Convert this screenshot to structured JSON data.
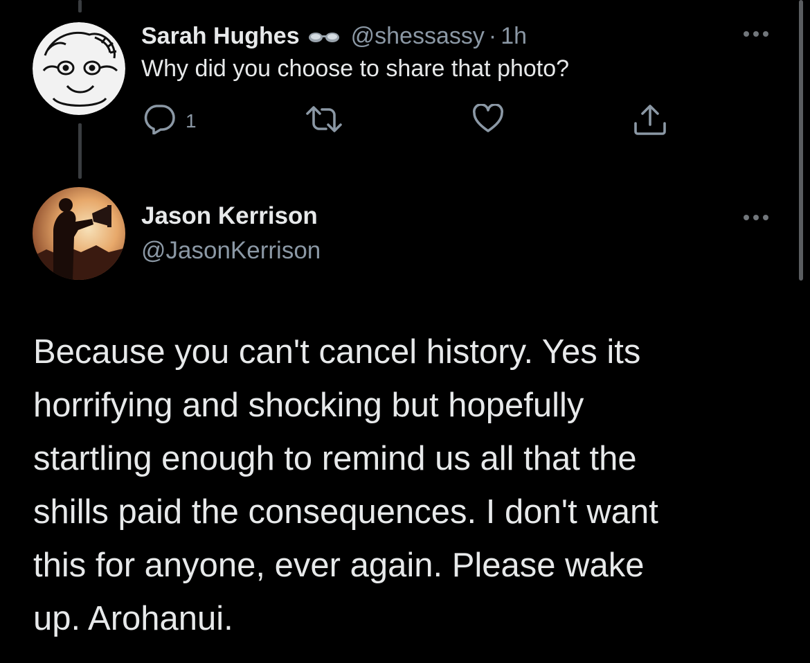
{
  "parent_tweet": {
    "display_name": "Sarah Hughes",
    "badge_icon": "glasses-icon",
    "handle": "@shessassy",
    "separator": "·",
    "time": "1h",
    "text": "Why did you choose to share that photo?",
    "reply_count": "1",
    "actions": [
      "reply-icon",
      "retweet-icon",
      "like-icon",
      "share-icon"
    ]
  },
  "main_tweet": {
    "display_name": "Jason Kerrison",
    "handle": "@JasonKerrison",
    "text_lines": [
      "Because you can't cancel history. Yes its",
      "horrifying and shocking but hopefully",
      "startling enough to remind us all that the",
      "shills paid the consequences. I don't want",
      "this for anyone, ever again. Please wake",
      "up. Arohanui."
    ]
  },
  "colors": {
    "background": "#000000",
    "primary_text": "#e7e9ea",
    "secondary_text": "#8b98a5",
    "thread_line": "#3a3d40"
  }
}
